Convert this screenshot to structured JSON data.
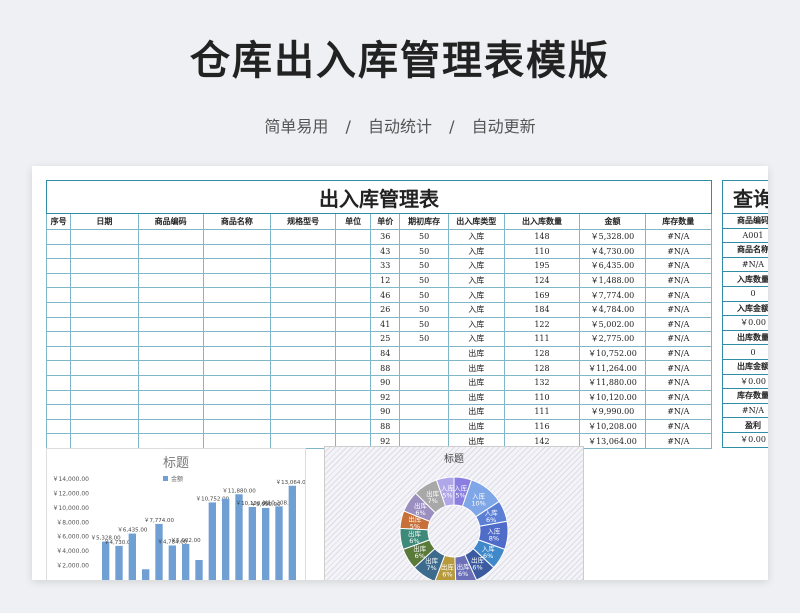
{
  "title": "仓库出入库管理表模版",
  "subtitle": [
    "简单易用",
    "/",
    "自动统计",
    "/",
    "自动更新"
  ],
  "table": {
    "title": "出入库管理表",
    "headers": [
      "序号",
      "日期",
      "商品编码",
      "商品名称",
      "规格型号",
      "单位",
      "单价",
      "期初库存",
      "出入库类型",
      "出入库数量",
      "金额",
      "库存数量"
    ],
    "rows": [
      [
        "36",
        "50",
        "入库",
        "148",
        "￥5,328.00",
        "#N/A"
      ],
      [
        "43",
        "50",
        "入库",
        "110",
        "￥4,730.00",
        "#N/A"
      ],
      [
        "33",
        "50",
        "入库",
        "195",
        "￥6,435.00",
        "#N/A"
      ],
      [
        "12",
        "50",
        "入库",
        "124",
        "￥1,488.00",
        "#N/A"
      ],
      [
        "46",
        "50",
        "入库",
        "169",
        "￥7,774.00",
        "#N/A"
      ],
      [
        "26",
        "50",
        "入库",
        "184",
        "￥4,784.00",
        "#N/A"
      ],
      [
        "41",
        "50",
        "入库",
        "122",
        "￥5,002.00",
        "#N/A"
      ],
      [
        "25",
        "50",
        "入库",
        "111",
        "￥2,775.00",
        "#N/A"
      ],
      [
        "84",
        "",
        "出库",
        "128",
        "￥10,752.00",
        "#N/A"
      ],
      [
        "88",
        "",
        "出库",
        "128",
        "￥11,264.00",
        "#N/A"
      ],
      [
        "90",
        "",
        "出库",
        "132",
        "￥11,880.00",
        "#N/A"
      ],
      [
        "92",
        "",
        "出库",
        "110",
        "￥10,120.00",
        "#N/A"
      ],
      [
        "90",
        "",
        "出库",
        "111",
        "￥9,990.00",
        "#N/A"
      ],
      [
        "88",
        "",
        "出库",
        "116",
        "￥10,208.00",
        "#N/A"
      ],
      [
        "92",
        "",
        "出库",
        "142",
        "￥13,064.00",
        "#N/A"
      ]
    ]
  },
  "query": {
    "title": "查询",
    "items": [
      {
        "label": "商品编码",
        "value": "A001"
      },
      {
        "label": "商品名称",
        "value": "#N/A"
      },
      {
        "label": "入库数量",
        "value": "0"
      },
      {
        "label": "入库金额",
        "value": "￥0.00"
      },
      {
        "label": "出库数量",
        "value": "0"
      },
      {
        "label": "出库金额",
        "value": "￥0.00"
      },
      {
        "label": "库存数量",
        "value": "#N/A"
      },
      {
        "label": "盈利",
        "value": "￥0.00"
      }
    ]
  },
  "colors": {
    "bar": "#6f9fd3",
    "border": "#2f8ea6",
    "grid": "#7fb7c8"
  },
  "chart_data": [
    {
      "type": "bar",
      "title": "标题",
      "series": [
        {
          "name": "金额",
          "values": [
            5328,
            4730,
            6435,
            1488,
            7774,
            4784,
            5002,
            2775,
            10752,
            11264,
            11880,
            10120,
            9990,
            10208,
            13064
          ]
        }
      ],
      "yticks": [
        "￥14,000.00",
        "￥12,000.00",
        "￥10,000.00",
        "￥8,000.00",
        "￥6,000.00",
        "￥4,000.00",
        "￥2,000.00"
      ],
      "data_labels": [
        "￥5,328.00",
        "￥4,730.00",
        "￥6,435.00",
        "",
        "￥7,774.00",
        "￥4,784.00",
        "￥5,002.00",
        "",
        "￥10,752.00",
        "",
        "￥11,880.00",
        "￥10,120.00",
        "￥9,990.00",
        "￥10,208.00",
        "￥13,064.00"
      ],
      "ylim": [
        0,
        14000
      ],
      "legend": "top"
    },
    {
      "type": "pie",
      "title": "标题",
      "slices": [
        {
          "label": "入库",
          "pct": "5%",
          "value": 5,
          "color": "#8a7fe0"
        },
        {
          "label": "入库",
          "pct": "10%",
          "value": 10,
          "color": "#7fa6e6"
        },
        {
          "label": "入库",
          "pct": "6%",
          "value": 6,
          "color": "#5c7fd6"
        },
        {
          "label": "入库",
          "pct": "8%",
          "value": 8,
          "color": "#4f6cc9"
        },
        {
          "label": "入库",
          "pct": "6%",
          "value": 6,
          "color": "#3f88c9"
        },
        {
          "label": "出库",
          "pct": "6%",
          "value": 6,
          "color": "#3b5aa0"
        },
        {
          "label": "出库",
          "pct": "6%",
          "value": 6,
          "color": "#6a6fb8"
        },
        {
          "label": "出库",
          "pct": "6%",
          "value": 6,
          "color": "#b79a3b"
        },
        {
          "label": "出库",
          "pct": "7%",
          "value": 7,
          "color": "#3c6b8e"
        },
        {
          "label": "出库",
          "pct": "6%",
          "value": 6,
          "color": "#5a7a3a"
        },
        {
          "label": "出库",
          "pct": "6%",
          "value": 6,
          "color": "#3d8a7a"
        },
        {
          "label": "出库",
          "pct": "5%",
          "value": 5,
          "color": "#c8703a"
        },
        {
          "label": "出库",
          "pct": "6%",
          "value": 6,
          "color": "#9b8fc0"
        },
        {
          "label": "出库",
          "pct": "7%",
          "value": 7,
          "color": "#a8a8a8"
        },
        {
          "label": "入库",
          "pct": "5%",
          "value": 5,
          "color": "#b0a7e8"
        }
      ]
    }
  ]
}
